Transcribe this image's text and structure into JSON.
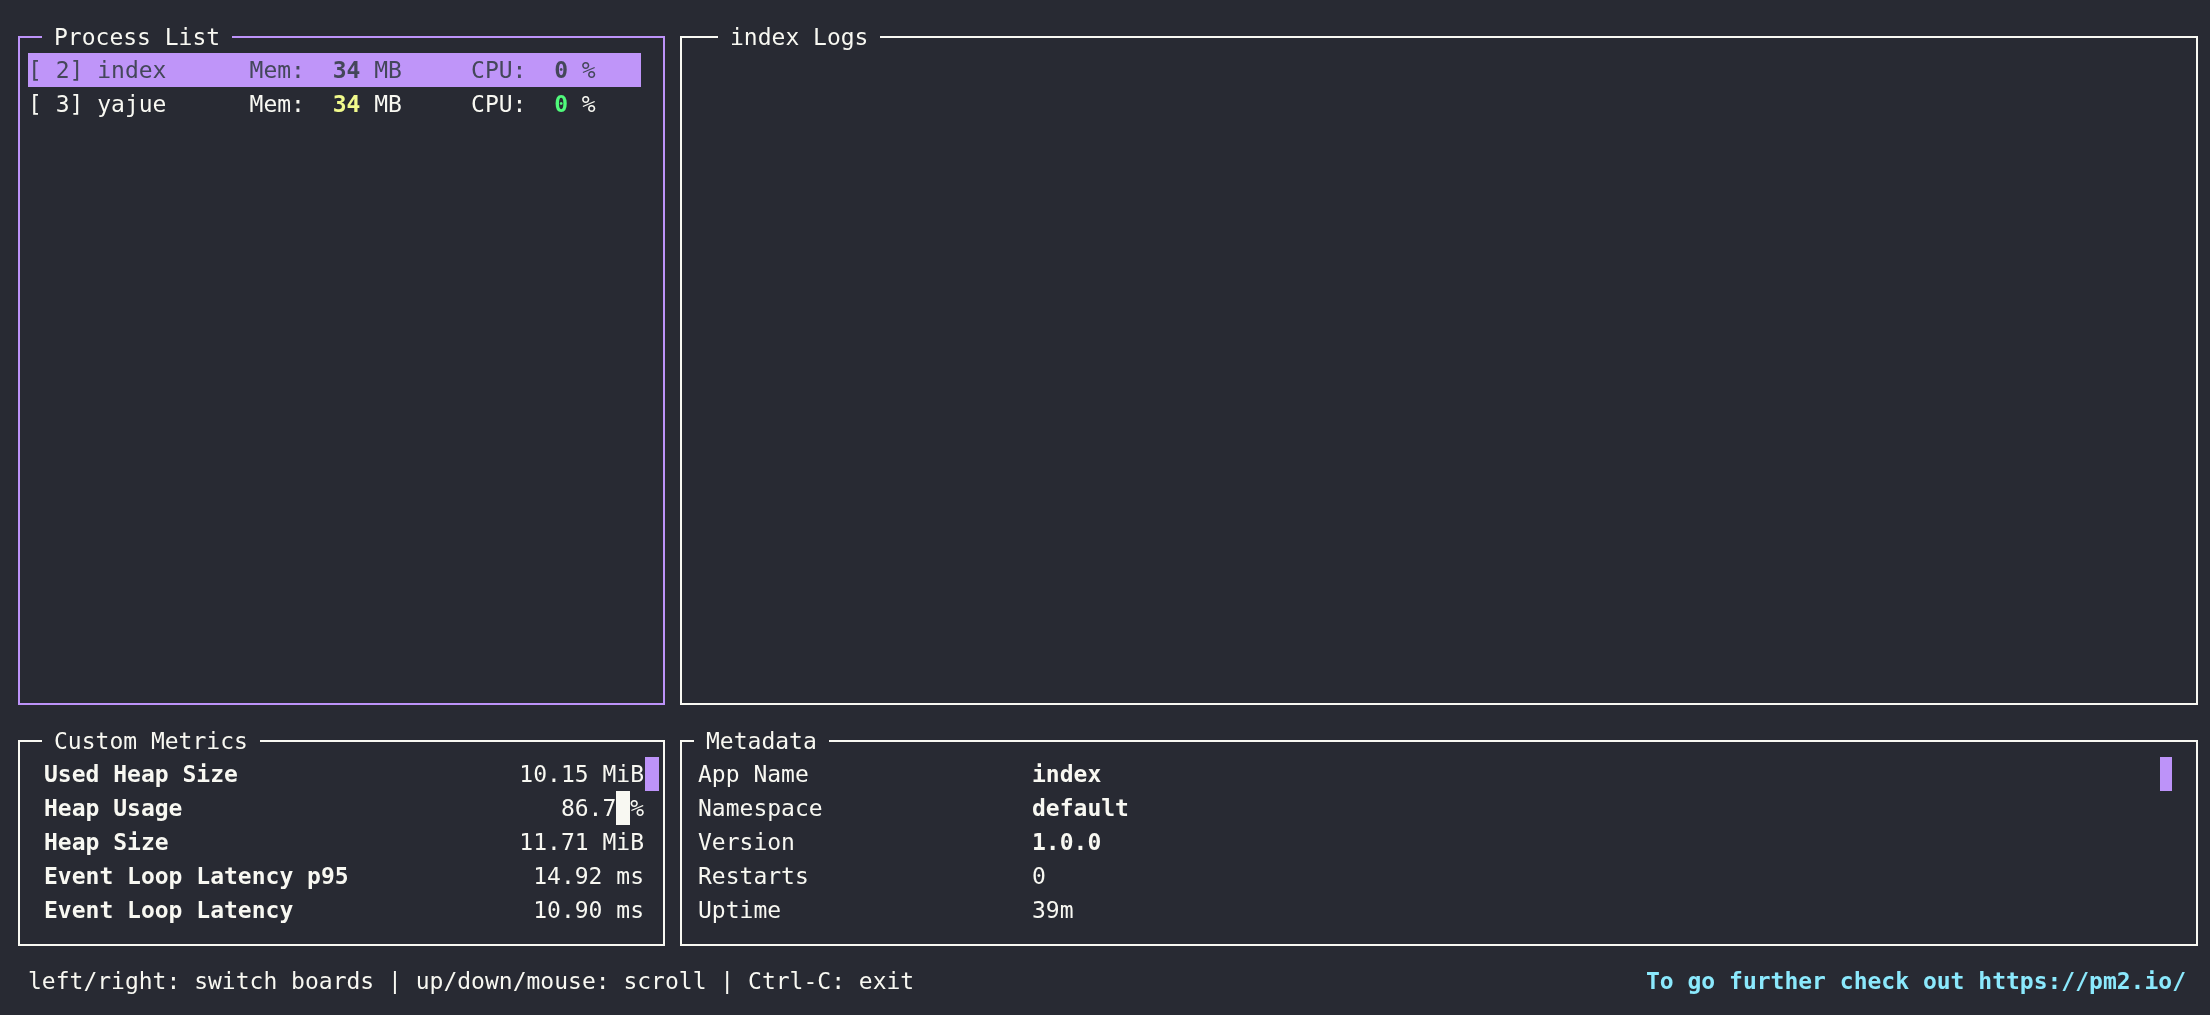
{
  "process_list": {
    "title": "Process List",
    "focused": true,
    "processes": [
      {
        "id": "[ 2]",
        "name": "index",
        "mem_label": "Mem:",
        "mem": "34",
        "mem_unit": "MB",
        "cpu_label": "CPU:",
        "cpu": "0",
        "cpu_unit": "%",
        "selected": true
      },
      {
        "id": "[ 3]",
        "name": "yajue",
        "mem_label": "Mem:",
        "mem": "34",
        "mem_unit": "MB",
        "cpu_label": "CPU:",
        "cpu": "0",
        "cpu_unit": "%",
        "selected": false
      }
    ]
  },
  "logs": {
    "title": "index Logs",
    "focused": false
  },
  "custom_metrics": {
    "title": "Custom Metrics",
    "focused": false,
    "rows": [
      {
        "label": "Used Heap Size",
        "value": "10.15",
        "unit": "MiB",
        "cursor": false
      },
      {
        "label": "Heap Usage",
        "value": "86.7",
        "unit": "%",
        "cursor": true
      },
      {
        "label": "Heap Size",
        "value": "11.71",
        "unit": "MiB",
        "cursor": false
      },
      {
        "label": "Event Loop Latency p95",
        "value": "14.92",
        "unit": "ms",
        "cursor": false
      },
      {
        "label": "Event Loop Latency",
        "value": "10.90",
        "unit": "ms",
        "cursor": false
      }
    ]
  },
  "metadata": {
    "title": "Metadata",
    "focused": false,
    "rows": [
      {
        "label": "App Name",
        "value": "index",
        "bold": true
      },
      {
        "label": "Namespace",
        "value": "default",
        "bold": true
      },
      {
        "label": "Version",
        "value": "1.0.0",
        "bold": true
      },
      {
        "label": "Restarts",
        "value": "0",
        "bold": false
      },
      {
        "label": "Uptime",
        "value": "39m",
        "bold": false
      }
    ]
  },
  "footer": {
    "help": "left/right: switch boards | up/down/mouse: scroll | Ctrl-C: exit",
    "link": "To go further check out https://pm2.io/"
  }
}
